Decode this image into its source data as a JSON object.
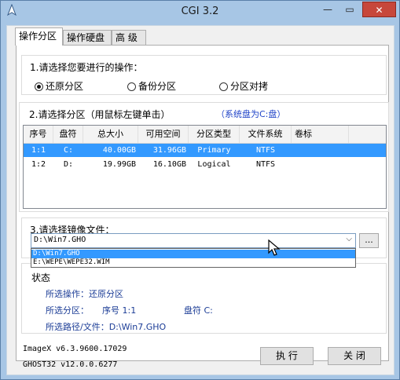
{
  "window": {
    "title": "CGI 3.2",
    "min_glyph": "—",
    "max_glyph": "▭",
    "close_glyph": "✕"
  },
  "tabs": [
    "操作分区",
    "操作硬盘",
    "高  级"
  ],
  "section1": {
    "title": "1.请选择您要进行的操作：",
    "options": [
      "还原分区",
      "备份分区",
      "分区对拷"
    ],
    "selected": 0
  },
  "section2": {
    "title": "2.请选择分区（用鼠标左键单击）",
    "system_disk": "（系统盘为C:盘）",
    "columns": [
      "序号",
      "盘符",
      "总大小",
      "可用空间",
      "分区类型",
      "文件系统",
      "卷标"
    ],
    "rows": [
      {
        "index": "1:1",
        "drive": "C:",
        "total": "40.00GB",
        "free": "31.96GB",
        "type": "Primary",
        "fs": "NTFS",
        "label": ""
      },
      {
        "index": "1:2",
        "drive": "D:",
        "total": "19.99GB",
        "free": "16.10GB",
        "type": "Logical",
        "fs": "NTFS",
        "label": ""
      }
    ],
    "selected_row": 0
  },
  "section3": {
    "title": "3.请选择镜像文件：",
    "value": "D:\\Win7.GHO",
    "browse_label": "...",
    "options": [
      "D:\\Win7.GHO",
      "E:\\WEPE\\WEPE32.WIM"
    ]
  },
  "status": {
    "label": "状态",
    "operation": "所选操作：还原分区",
    "partition_prefix": "所选分区：",
    "partition_index": "序号 1:1",
    "partition_drive": "盘符 C:",
    "path": "所选路径/文件：D:\\Win7.GHO"
  },
  "footer": {
    "imagex": "ImageX v6.3.9600.17029",
    "ghost": "GHOST32 v12.0.0.6277",
    "execute_label": "执 行",
    "close_label": "关 闭"
  },
  "colors": {
    "selection": "#3399ff",
    "status_text": "#1b3c96",
    "system_disk_text": "#1f43c8"
  }
}
